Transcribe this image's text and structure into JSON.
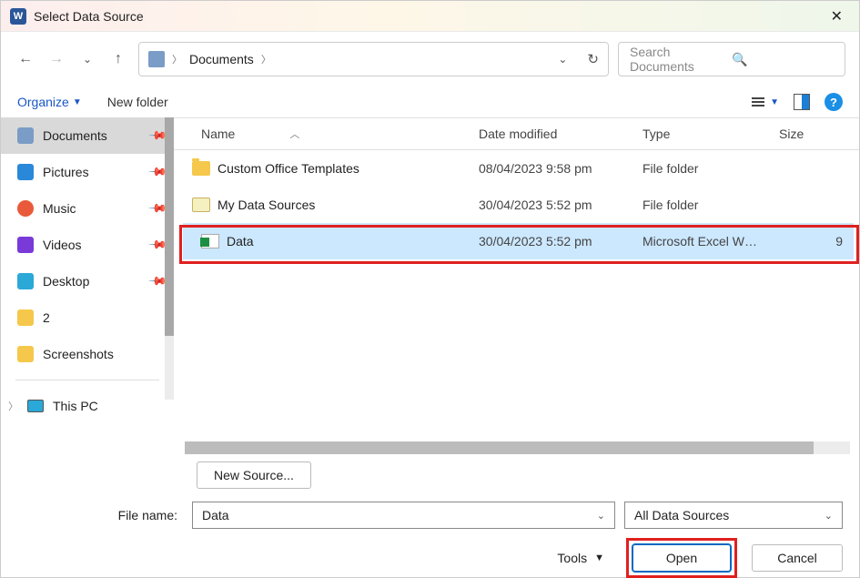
{
  "title": "Select Data Source",
  "breadcrumb": {
    "location": "Documents"
  },
  "search": {
    "placeholder": "Search Documents"
  },
  "commands": {
    "organize": "Organize",
    "new_folder": "New folder"
  },
  "sidebar": {
    "items": [
      {
        "label": "Documents",
        "pinned": true,
        "selected": true,
        "icon": "doc"
      },
      {
        "label": "Pictures",
        "pinned": true,
        "icon": "pic"
      },
      {
        "label": "Music",
        "pinned": true,
        "icon": "mus"
      },
      {
        "label": "Videos",
        "pinned": true,
        "icon": "vid"
      },
      {
        "label": "Desktop",
        "pinned": true,
        "icon": "desk"
      },
      {
        "label": "2",
        "pinned": false,
        "icon": "fold"
      },
      {
        "label": "Screenshots",
        "pinned": false,
        "icon": "fold"
      }
    ],
    "this_pc": "This PC"
  },
  "columns": {
    "name": "Name",
    "date": "Date modified",
    "type": "Type",
    "size": "Size"
  },
  "files": [
    {
      "name": "Custom Office Templates",
      "date": "08/04/2023 9:58 pm",
      "type": "File folder",
      "size": "",
      "icon": "fold"
    },
    {
      "name": "My Data Sources",
      "date": "30/04/2023 5:52 pm",
      "type": "File folder",
      "size": "",
      "icon": "ds"
    },
    {
      "name": "Data",
      "date": "30/04/2023 5:52 pm",
      "type": "Microsoft Excel W…",
      "size": "9",
      "icon": "xl",
      "selected": true
    }
  ],
  "buttons": {
    "new_source": "New Source...",
    "tools": "Tools",
    "open": "Open",
    "cancel": "Cancel"
  },
  "filename": {
    "label": "File name:",
    "value": "Data"
  },
  "filetype": {
    "value": "All Data Sources"
  }
}
